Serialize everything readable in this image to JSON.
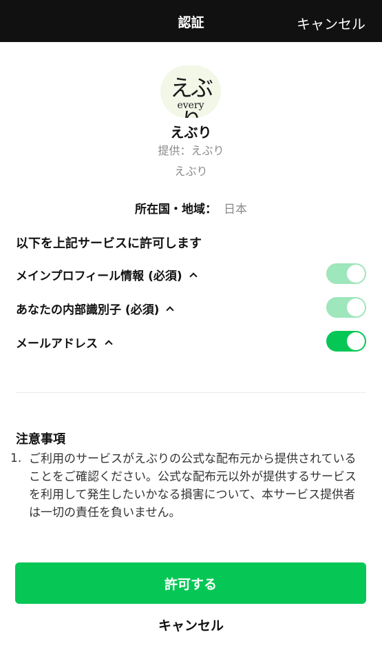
{
  "header": {
    "title": "認証",
    "cancel_label": "キャンセル"
  },
  "app": {
    "logo_text": "えぶり",
    "logo_subtext": "every",
    "name": "えぶり",
    "provider": "提供：えぶり",
    "description": "えぶり"
  },
  "region": {
    "label": "所在国・地域：",
    "value": "日本"
  },
  "permissions": {
    "heading": "以下を上記サービスに許可します",
    "items": [
      {
        "label": "メインプロフィール情報 (必須)",
        "enabled": true,
        "required": true
      },
      {
        "label": "あなたの内部識別子 (必須)",
        "enabled": true,
        "required": true
      },
      {
        "label": "メールアドレス",
        "enabled": true,
        "required": false
      }
    ]
  },
  "notes": {
    "heading": "注意事項",
    "items": [
      {
        "number": "1.",
        "text": "ご利用のサービスがえぶりの公式な配布元から提供されていることをご確認ください。公式な配布元以外が提供するサービスを利用して発生したいかなる損害について、本サービス提供者は一切の責任を負いません。"
      }
    ]
  },
  "actions": {
    "allow_label": "許可する",
    "cancel_label": "キャンセル"
  },
  "colors": {
    "accent": "#06c755",
    "toggle_locked": "#9ee6bb",
    "header_bg": "#111111"
  }
}
